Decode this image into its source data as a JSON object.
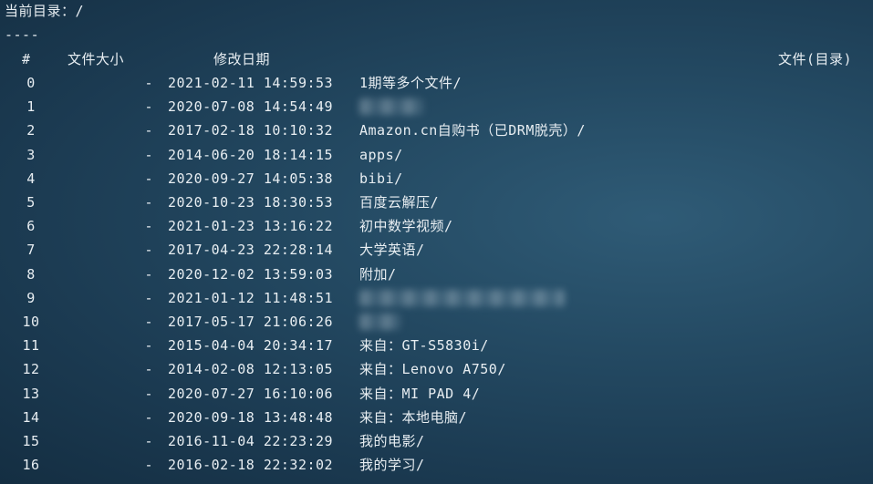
{
  "terminal": {
    "current_dir_label": "当前目录：/",
    "separator": "----",
    "headers": {
      "index": "#",
      "size": "文件大小",
      "modified": "修改日期",
      "name": "文件(目录)"
    },
    "rows": [
      {
        "index": "0",
        "size": "-",
        "modified": "2021-02-11 14:59:53",
        "name": "1期等多个文件/",
        "obscured": false
      },
      {
        "index": "1",
        "size": "-",
        "modified": "2020-07-08 14:54:49",
        "name": "",
        "obscured": true
      },
      {
        "index": "2",
        "size": "-",
        "modified": "2017-02-18 10:10:32",
        "name": "Amazon.cn自购书（已DRM脱壳）/",
        "obscured": false
      },
      {
        "index": "3",
        "size": "-",
        "modified": "2014-06-20 18:14:15",
        "name": "apps/",
        "obscured": false
      },
      {
        "index": "4",
        "size": "-",
        "modified": "2020-09-27 14:05:38",
        "name": "bibi/",
        "obscured": false
      },
      {
        "index": "5",
        "size": "-",
        "modified": "2020-10-23 18:30:53",
        "name": "百度云解压/",
        "obscured": false
      },
      {
        "index": "6",
        "size": "-",
        "modified": "2021-01-23 13:16:22",
        "name": "初中数学视频/",
        "obscured": false
      },
      {
        "index": "7",
        "size": "-",
        "modified": "2017-04-23 22:28:14",
        "name": "大学英语/",
        "obscured": false
      },
      {
        "index": "8",
        "size": "-",
        "modified": "2020-12-02 13:59:03",
        "name": "附加/",
        "obscured": false
      },
      {
        "index": "9",
        "size": "-",
        "modified": "2021-01-12 11:48:51",
        "name": "",
        "obscured": true
      },
      {
        "index": "10",
        "size": "-",
        "modified": "2017-05-17 21:06:26",
        "name": "",
        "obscured": true
      },
      {
        "index": "11",
        "size": "-",
        "modified": "2015-04-04 20:34:17",
        "name": "来自：GT-S5830i/",
        "obscured": false
      },
      {
        "index": "12",
        "size": "-",
        "modified": "2014-02-08 12:13:05",
        "name": "来自：Lenovo A750/",
        "obscured": false
      },
      {
        "index": "13",
        "size": "-",
        "modified": "2020-07-27 16:10:06",
        "name": "来自：MI PAD 4/",
        "obscured": false
      },
      {
        "index": "14",
        "size": "-",
        "modified": "2020-09-18 13:48:48",
        "name": "来自：本地电脑/",
        "obscured": false
      },
      {
        "index": "15",
        "size": "-",
        "modified": "2016-11-04 22:23:29",
        "name": "我的电影/",
        "obscured": false
      },
      {
        "index": "16",
        "size": "-",
        "modified": "2016-02-18 22:32:02",
        "name": "我的学习/",
        "obscured": false
      }
    ]
  }
}
